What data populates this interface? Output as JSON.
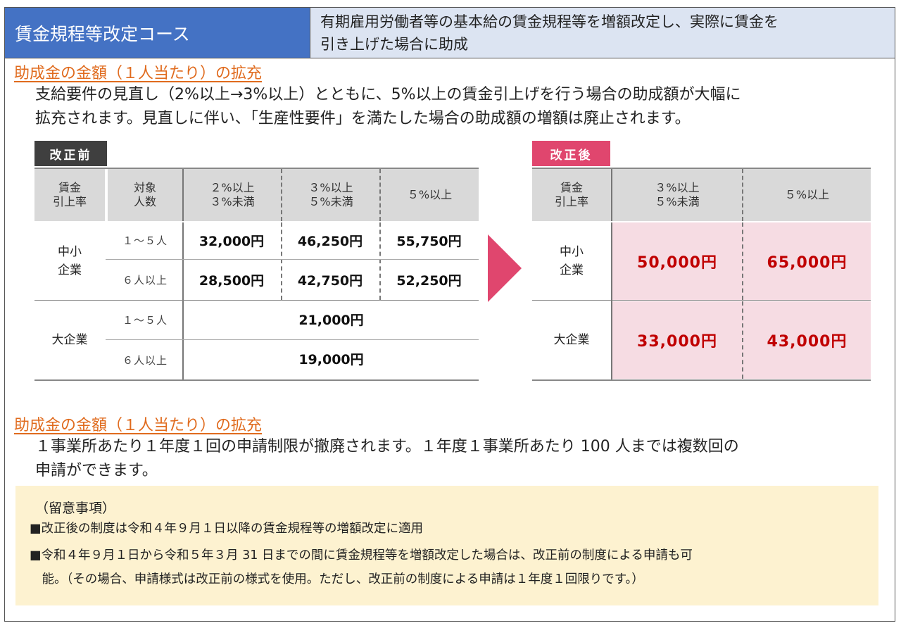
{
  "header": {
    "title": "賃金規程等改定コース",
    "desc_line1": "有期雇用労働者等の基本給の賃金規程等を増額改定し、実際に賃金を",
    "desc_line2": "引き上げた場合に助成"
  },
  "section1": {
    "heading": "助成金の金額（１人当たり）の拡充",
    "line1": "支給要件の見直し（2%以上→3%以上）とともに、5%以上の賃金引上げを行う場合の助成額が大幅に",
    "line2": "拡充されます。見直しに伴い、「生産性要件」を満たした場合の助成額の増額は廃止されます。"
  },
  "before": {
    "tag": "改正前",
    "tag_color": "#3f3f3f",
    "headers": {
      "rate_l1": "賃金",
      "rate_l2": "引上率",
      "count_l1": "対象",
      "count_l2": "人数",
      "c1_l1": "２%以上",
      "c1_l2": "３%未満",
      "c2_l1": "３%以上",
      "c2_l2": "５%未満",
      "c3": "５%以上"
    },
    "sme_l1": "中小",
    "sme_l2": "企業",
    "large": "大企業",
    "size_small": "１～５人",
    "size_large": "６人以上",
    "sme_small": [
      "32,000円",
      "46,250円",
      "55,750円"
    ],
    "sme_large": [
      "28,500円",
      "42,750円",
      "52,250円"
    ],
    "large_small": "21,000円",
    "large_large": "19,000円"
  },
  "after": {
    "tag": "改正後",
    "tag_color": "#e0466e",
    "headers": {
      "rate_l1": "賃金",
      "rate_l2": "引上率",
      "c1_l1": "３%以上",
      "c1_l2": "５%未満",
      "c2": "５%以上"
    },
    "sme_l1": "中小",
    "sme_l2": "企業",
    "large": "大企業",
    "sme": [
      "50,000円",
      "65,000円"
    ],
    "large_values": [
      "33,000円",
      "43,000円"
    ],
    "amount_color": "#c00000",
    "cell_color": "#f6dce3"
  },
  "section2": {
    "heading": "助成金の金額（１人当たり）の拡充",
    "line1": "１事業所あたり１年度１回の申請制限が撤廃されます。１年度１事業所あたり 100 人までは複数回の",
    "line2": "申請ができます。"
  },
  "notes": {
    "title": "（留意事項）",
    "item1": "■改正後の制度は令和４年９月１日以降の賃金規程等の増額改定に適用",
    "item2_l1": "■令和４年９月１日から令和５年３月 31 日までの間に賃金規程等を増額改定した場合は、改正前の制度による申請も可",
    "item2_l2": "　能。（その場合、申請様式は改正前の様式を使用。ただし、改正前の制度による申請は１年度１回限りです。）",
    "bg_color": "#fdf2d0"
  }
}
